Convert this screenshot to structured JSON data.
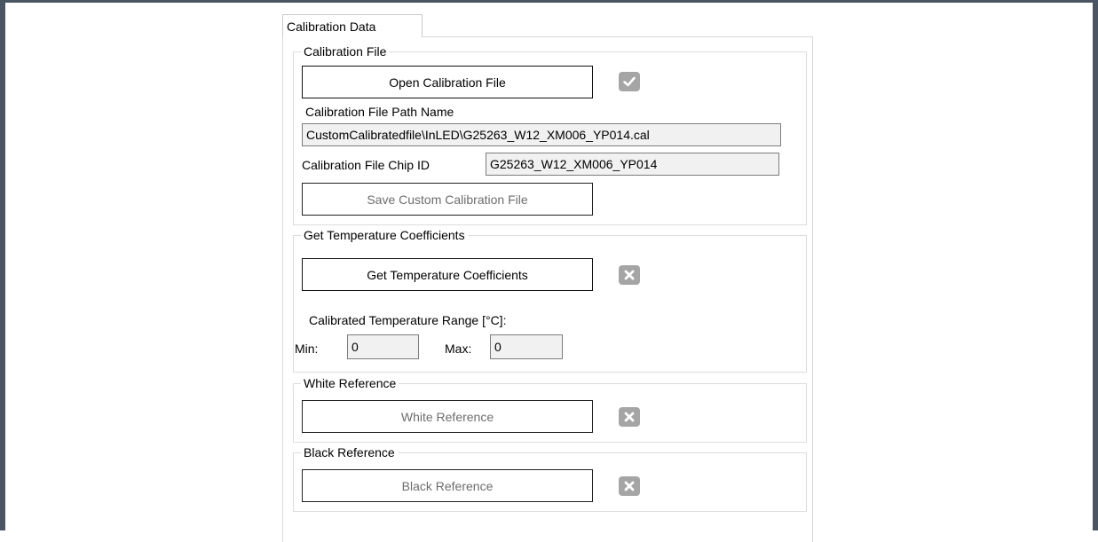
{
  "tab": {
    "label": "Calibration Data"
  },
  "calibration_file": {
    "group_title": "Calibration File",
    "open_button": "Open Calibration File",
    "open_status_icon": "check-icon",
    "path_label": "Calibration File Path Name",
    "path_value": "CustomCalibratedfile\\InLED\\G25263_W12_XM006_YP014.cal",
    "chip_id_label": "Calibration File Chip ID",
    "chip_id_value": "G25263_W12_XM006_YP014",
    "save_button": "Save Custom Calibration File"
  },
  "temperature": {
    "group_title": "Get Temperature Coefficients",
    "get_button": "Get Temperature Coefficients",
    "status_icon": "close-icon",
    "range_label": "Calibrated Temperature Range [°C]:",
    "min_label": "Min:",
    "min_value": "0",
    "max_label": "Max:",
    "max_value": "0"
  },
  "white_reference": {
    "group_title": "White Reference",
    "button": "White Reference",
    "status_icon": "close-icon"
  },
  "black_reference": {
    "group_title": "Black Reference",
    "button": "Black Reference",
    "status_icon": "close-icon"
  },
  "colors": {
    "frame": "#4a5563",
    "status_icon_bg": "#a5a5a5",
    "field_bg": "#f1f1f1"
  }
}
